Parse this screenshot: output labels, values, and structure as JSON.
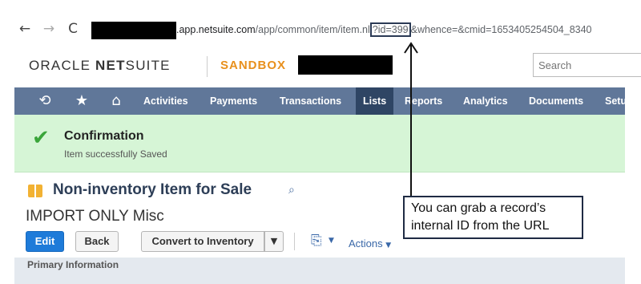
{
  "browser": {
    "back_icon": "←",
    "forward_icon": "→",
    "reload_icon": "C",
    "url": {
      "host_suffix": ".app.netsuite.com",
      "path": "/app/common/item/item.nl",
      "query_id": "?id=399",
      "query_rest": "&whence=&cmid=1653405254504_8340"
    }
  },
  "header": {
    "brand_oracle": "ORACLE",
    "brand_netsuite_bold": "NET",
    "brand_netsuite_rest": "SUITE",
    "environment": "SANDBOX",
    "search_placeholder": "Search"
  },
  "nav": {
    "items": [
      {
        "label": "Activities"
      },
      {
        "label": "Payments"
      },
      {
        "label": "Transactions"
      },
      {
        "label": "Lists",
        "active": true
      },
      {
        "label": "Reports"
      },
      {
        "label": "Analytics"
      },
      {
        "label": "Documents"
      },
      {
        "label": "Setu"
      }
    ]
  },
  "confirmation": {
    "title": "Confirmation",
    "message": "Item successfully Saved"
  },
  "record": {
    "type": "Non-inventory Item for Sale",
    "name": "IMPORT ONLY Misc"
  },
  "toolbar": {
    "edit_label": "Edit",
    "back_label": "Back",
    "convert_label": "Convert to Inventory",
    "dropdown_icon": "▼",
    "actions_label": "Actions"
  },
  "subtab": {
    "label": "Primary Information"
  },
  "annotation": {
    "line1": "You can grab a record’s",
    "line2": "internal ID from the URL"
  },
  "colors": {
    "nav_bg": "#607799",
    "nav_active": "#2f4564",
    "confirm_bg": "#d6f5d6",
    "edit_button": "#1e7bd9",
    "sandbox": "#e8901d"
  }
}
